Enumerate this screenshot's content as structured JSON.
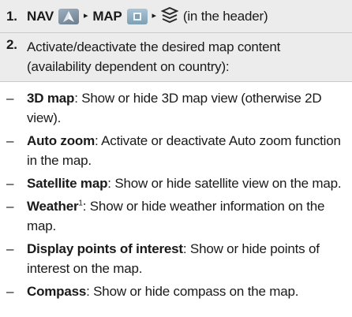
{
  "step1": {
    "number": "1.",
    "nav": "NAV",
    "map": "MAP",
    "note": "(in the header)",
    "arrow": "▸"
  },
  "step2": {
    "number": "2.",
    "text": "Activate/deactivate the desired map content (availability dependent on country):"
  },
  "items": [
    {
      "dash": "–",
      "term": "3D map",
      "sup": "",
      "desc": ": Show or hide 3D map view (otherwise 2D view)."
    },
    {
      "dash": "–",
      "term": "Auto zoom",
      "sup": "",
      "desc": ": Activate or deactivate Auto zoom function in the map."
    },
    {
      "dash": "–",
      "term": "Satellite map",
      "sup": "",
      "desc": ": Show or hide satellite view on the map."
    },
    {
      "dash": "–",
      "term": "Weather",
      "sup": "1",
      "desc": ": Show or hide weather information on the map."
    },
    {
      "dash": "–",
      "term": "Display points of interest",
      "sup": "",
      "desc": ": Show or hide points of interest on the map."
    },
    {
      "dash": "–",
      "term": "Compass",
      "sup": "",
      "desc": ": Show or hide compass on the map."
    }
  ],
  "icons": {
    "nav": "nav-icon",
    "map": "map-icon",
    "layers": "layers-icon"
  }
}
